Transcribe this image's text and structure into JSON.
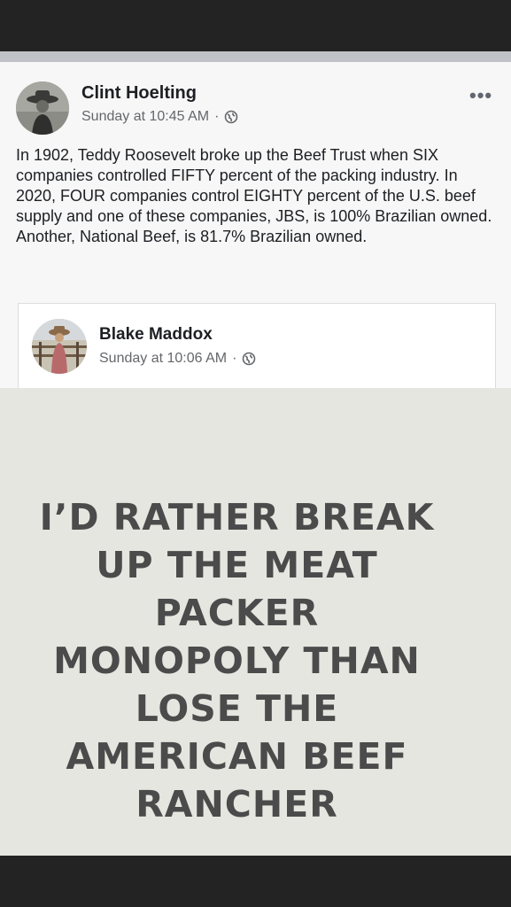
{
  "post": {
    "author": "Clint Hoelting",
    "timestamp": "Sunday at 10:45 AM",
    "separator": "·",
    "privacy_icon": "globe-icon",
    "more_icon": "more-options-icon",
    "more_glyph": "•••",
    "text": "In 1902, Teddy Roosevelt broke up the Beef Trust when SIX companies controlled FIFTY percent of the packing industry. In 2020, FOUR companies control EIGHTY percent of the U.S. beef supply and one of these companies, JBS, is 100% Brazilian owned. Another, National Beef, is 81.7% Brazilian owned."
  },
  "shared_post": {
    "author": "Blake Maddox",
    "timestamp": "Sunday at 10:06 AM",
    "separator": "·",
    "privacy_icon": "globe-icon",
    "image_text": "I’D RATHER BREAK\nUP THE MEAT\nPACKER\nMONOPOLY THAN\nLOSE THE\nAMERICAN BEEF\nRANCHER"
  },
  "colors": {
    "frame_dark": "#232323",
    "card_bg": "#f7f7f7",
    "secondary_text": "#65676b",
    "image_bg": "#e6e6e1",
    "image_text": "#4b4b4b"
  }
}
